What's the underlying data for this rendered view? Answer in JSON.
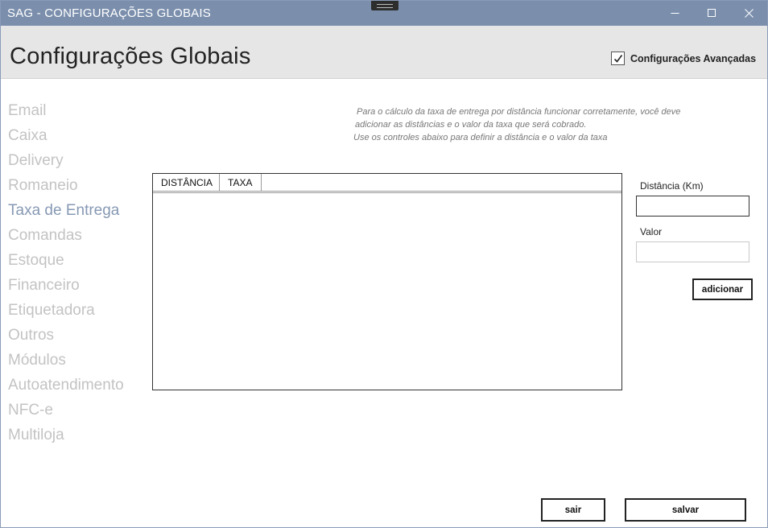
{
  "window": {
    "title": "SAG - CONFIGURAÇÕES GLOBAIS"
  },
  "header": {
    "title": "Configurações Globais",
    "advanced_checkbox": {
      "label": "Configurações Avançadas",
      "checked": true
    }
  },
  "sidebar": {
    "items": [
      {
        "label": "Email"
      },
      {
        "label": "Caixa"
      },
      {
        "label": "Delivery"
      },
      {
        "label": "Romaneio"
      },
      {
        "label": "Taxa de Entrega",
        "active": true
      },
      {
        "label": "Comandas"
      },
      {
        "label": "Estoque"
      },
      {
        "label": "Financeiro"
      },
      {
        "label": "Etiquetadora"
      },
      {
        "label": "Outros"
      },
      {
        "label": "Módulos"
      },
      {
        "label": "Autoatendimento"
      },
      {
        "label": "NFC-e"
      },
      {
        "label": "Multiloja"
      }
    ]
  },
  "info": {
    "line1": "Para o cálculo da taxa de entrega por distância funcionar corretamente, você deve",
    "line2": "adicionar as distâncias e o valor da taxa que será cobrado.",
    "line3": "Use os controles abaixo para definir a distância e o valor da taxa"
  },
  "table": {
    "columns": [
      "DISTÂNCIA",
      "TAXA"
    ],
    "rows": []
  },
  "form": {
    "distance_label": "Distância (Km)",
    "distance_value": "",
    "value_label": "Valor",
    "value_value": "",
    "add_button": "adicionar"
  },
  "footer": {
    "exit_button": "sair",
    "save_button": "salvar"
  },
  "colors": {
    "titlebar": "#7b8fad",
    "header_bg": "#e6e6e6",
    "nav_inactive": "#c3c3c3",
    "nav_active": "#8799b4"
  }
}
